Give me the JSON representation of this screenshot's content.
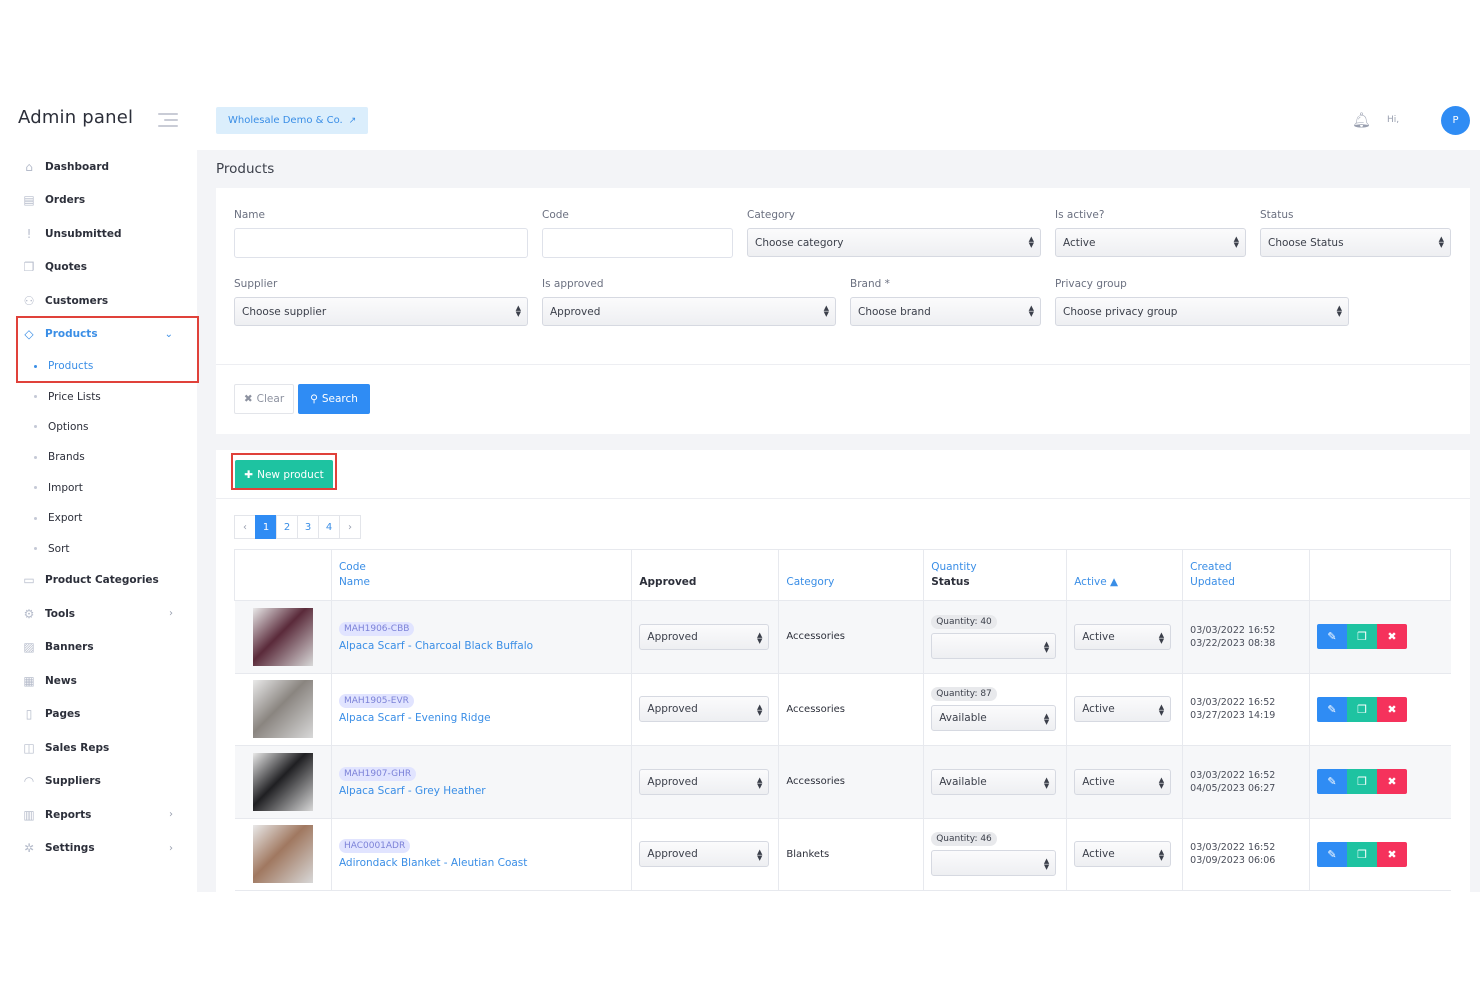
{
  "app": {
    "brand": "Admin panel"
  },
  "topbar": {
    "shop": "Wholesale Demo & Co.",
    "greeting": "Hi,",
    "avatar_initial": "P"
  },
  "sidebar": {
    "items": [
      {
        "label": "Dashboard",
        "icon": "home-icon"
      },
      {
        "label": "Orders",
        "icon": "document-icon"
      },
      {
        "label": "Unsubmitted",
        "icon": "exclamation-icon"
      },
      {
        "label": "Quotes",
        "icon": "copy-icon"
      },
      {
        "label": "Customers",
        "icon": "users-icon"
      },
      {
        "label": "Products",
        "icon": "tag-icon"
      }
    ],
    "product_subitems": [
      "Products",
      "Price Lists",
      "Options",
      "Brands",
      "Import",
      "Export",
      "Sort"
    ],
    "items_after": [
      {
        "label": "Product Categories",
        "icon": "folder-icon"
      },
      {
        "label": "Tools",
        "icon": "gear-icon"
      },
      {
        "label": "Banners",
        "icon": "image-icon"
      },
      {
        "label": "News",
        "icon": "newspaper-icon"
      },
      {
        "label": "Pages",
        "icon": "page-icon"
      },
      {
        "label": "Sales Reps",
        "icon": "briefcase-icon"
      },
      {
        "label": "Suppliers",
        "icon": "supplier-icon"
      },
      {
        "label": "Reports",
        "icon": "chart-icon"
      },
      {
        "label": "Settings",
        "icon": "settings-icon"
      }
    ]
  },
  "page": {
    "title": "Products"
  },
  "filters": {
    "name_label": "Name",
    "code_label": "Code",
    "category_label": "Category",
    "category_value": "Choose category",
    "is_active_label": "Is active?",
    "is_active_value": "Active",
    "status_label": "Status",
    "status_value": "Choose Status",
    "supplier_label": "Supplier",
    "supplier_value": "Choose supplier",
    "is_approved_label": "Is approved",
    "is_approved_value": "Approved",
    "brand_label": "Brand *",
    "brand_value": "Choose brand",
    "privacy_label": "Privacy group",
    "privacy_value": "Choose privacy group",
    "clear": "Clear",
    "search": "Search"
  },
  "products": {
    "new_button": "New product",
    "pages": [
      "1",
      "2",
      "3",
      "4"
    ],
    "current_page": "1",
    "columns": {
      "code": "Code",
      "name": "Name",
      "approved": "Approved",
      "category": "Category",
      "quantity": "Quantity",
      "status": "Status",
      "active": "Active ▲",
      "created": "Created",
      "updated": "Updated"
    },
    "rows": [
      {
        "code": "MAH1906-CBB",
        "name": "Alpaca Scarf - Charcoal Black Buffalo",
        "approved": "Approved",
        "category": "Accessories",
        "quantity": "Quantity: 40",
        "status": "",
        "active": "Active",
        "created": "03/03/2022 16:52",
        "updated": "03/22/2023 08:38",
        "thumb_color": "#5a2a3a"
      },
      {
        "code": "MAH1905-EVR",
        "name": "Alpaca Scarf - Evening Ridge",
        "approved": "Approved",
        "category": "Accessories",
        "quantity": "Quantity: 87",
        "status": "Available",
        "active": "Active",
        "created": "03/03/2022 16:52",
        "updated": "03/27/2023 14:19",
        "thumb_color": "#8a8580"
      },
      {
        "code": "MAH1907-GHR",
        "name": "Alpaca Scarf - Grey Heather",
        "approved": "Approved",
        "category": "Accessories",
        "quantity": "",
        "status": "Available",
        "active": "Active",
        "created": "03/03/2022 16:52",
        "updated": "04/05/2023 06:27",
        "thumb_color": "#1f1f22"
      },
      {
        "code": "HAC0001ADR",
        "name": "Adirondack Blanket - Aleutian Coast",
        "approved": "Approved",
        "category": "Blankets",
        "quantity": "Quantity: 46",
        "status": "",
        "active": "Active",
        "created": "03/03/2022 16:52",
        "updated": "03/09/2023 06:06",
        "thumb_color": "#a07860"
      }
    ]
  },
  "colors": {
    "accent": "#2f8cf4",
    "success": "#1ec3a1",
    "danger": "#f5325c",
    "highlight": "#e0413a"
  }
}
